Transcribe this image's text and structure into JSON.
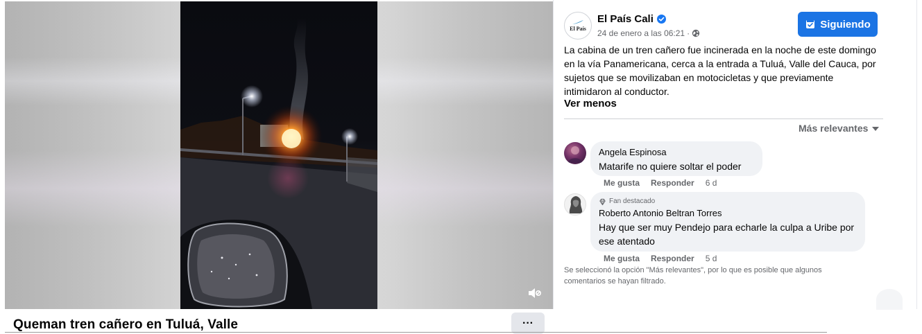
{
  "video": {
    "title": "Queman tren cañero en Tuluá, Valle",
    "mute_icon": "volume-muted-icon",
    "more_icon": "more-horizontal-icon",
    "more_label": "···"
  },
  "post": {
    "page_name": "El País Cali",
    "avatar_text": "El País",
    "verified_icon": "verified-badge-icon",
    "timestamp": "24 de enero a las 06:21",
    "meta_separator": "·",
    "audience_icon": "globe-icon",
    "follow_label": "Siguiendo",
    "follow_icon": "following-check-icon",
    "text": "La cabina de un tren cañero fue incinerada en la noche de este domingo en la vía Panamericana, cerca a la entrada a Tuluá, Valle del Cauca, por sujetos que se movilizaban en motocicletas y que previamente intimidaron al conductor.",
    "see_less": "Ver menos"
  },
  "comments": {
    "sort_label": "Más relevantes",
    "items": [
      {
        "author": "Angela Espinosa",
        "text": "Matarife no quiere soltar el poder",
        "like": "Me gusta",
        "reply": "Responder",
        "time": "6 d"
      },
      {
        "badge": "Fan destacado",
        "author": "Roberto Antonio Beltran Torres",
        "text": "Hay que ser muy Pendejo para echarle la culpa a Uribe por ese atentado",
        "like": "Me gusta",
        "reply": "Responder",
        "time": "5 d"
      }
    ],
    "filter_note": "Se seleccionó la opción \"Más relevantes\", por lo que es posible que algunos comentarios se hayan filtrado."
  },
  "colors": {
    "accent": "#1b74e4",
    "text": "#050505",
    "secondary_text": "#65676b",
    "bubble": "#f0f2f5"
  }
}
